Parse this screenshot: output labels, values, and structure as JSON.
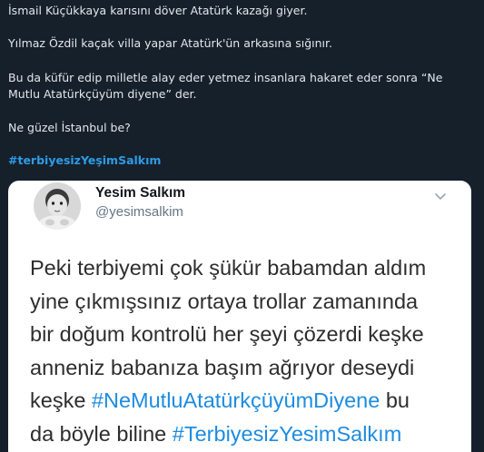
{
  "tweet": {
    "line1": "İsmail Küçükkaya karısını döver Atatürk kazağı giyer.",
    "line2": "Yılmaz Özdil kaçak villa yapar Atatürk'ün arkasına sığınır.",
    "line3a": "Bu da küfür edip milletle alay eder yetmez insanlara hakaret eder sonra “Ne",
    "line3b": "Mutlu Atatürkçüyüm diyene” der.",
    "line4": "Ne güzel İstanbul be?",
    "hashtag": "#terbiyesizYeşimSalkım"
  },
  "quoted": {
    "name": "Yesim Salkım",
    "handle": "@yesimsalkim",
    "avatar_icon": "baby-photo",
    "menu_icon": "chevron-down-icon",
    "lines": [
      {
        "text": "Peki terbiyemi çok şükür babamdan aldım"
      },
      {
        "text": "yine çıkmışsınız ortaya trollar zamanında"
      },
      {
        "text": "bir doğum kontrolü her şeyi çözerdi keşke"
      },
      {
        "text": "anneniz babanıza başım ağrıyor deseydi"
      },
      {
        "pre": "keşke ",
        "tag": "#NeMutluAtatürkçüyümDiyene",
        "post": " bu"
      },
      {
        "pre": "da böyle biline ",
        "tag": "#TerbiyesizYesimSalkım",
        "post": ""
      }
    ]
  },
  "colors": {
    "background": "#15202b",
    "text": "#e4e7ea",
    "hashtag": "#2f9be6",
    "quoted_hashtag": "#1d8ce0"
  }
}
